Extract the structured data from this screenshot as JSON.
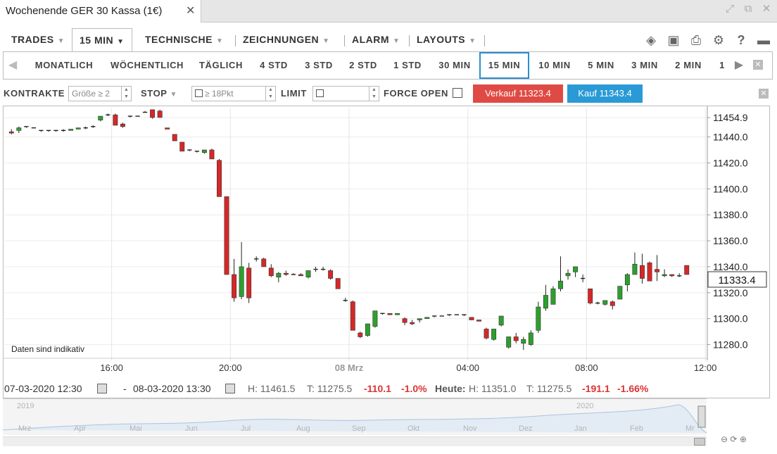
{
  "window": {
    "tab_title": "Wochenende GER 30 Kassa (1€)",
    "close_glyph": "✕"
  },
  "menu": {
    "trades": "TRADES",
    "interval": "15 MIN",
    "technische": "TECHNISCHE",
    "zeichnungen": "ZEICHNUNGEN",
    "alarm": "ALARM",
    "layouts": "LAYOUTS"
  },
  "toolbar_icons": [
    "layers-icon",
    "image-icon",
    "print-icon",
    "gear-icon",
    "help-icon",
    "chat-icon"
  ],
  "timeframes": [
    "MONATLICH",
    "WÖCHENTLICH",
    "TÄGLICH",
    "4 STD",
    "3 STD",
    "2 STD",
    "1 STD",
    "30 MIN",
    "15 MIN",
    "10 MIN",
    "5 MIN",
    "3 MIN",
    "2 MIN",
    "1"
  ],
  "active_timeframe": "15 MIN",
  "order": {
    "kontrakte_label": "KONTRAKTE",
    "kontrakte_placeholder": "Größe ≥ 2",
    "stop_label": "STOP",
    "stop_placeholder": "≥ 18Pkt",
    "limit_label": "LIMIT",
    "force_open_label": "FORCE OPEN",
    "sell_label": "Verkauf 11323.4",
    "buy_label": "Kauf 11343.4"
  },
  "chart_note": "Daten sind indikativ",
  "current_price": "11333.4",
  "info": {
    "from": "07-03-2020 12:30",
    "dash": "-",
    "to": "08-03-2020 13:30",
    "h": "H: 11461.5",
    "t": "T: 11275.5",
    "chg": "-110.1",
    "chg_pct": "-1.0%",
    "heute_label": "Heute:",
    "heute_h": "H: 11351.0",
    "heute_t": "T: 11275.5",
    "heute_chg": "-191.1",
    "heute_chg_pct": "-1.66%"
  },
  "navigator": {
    "years": [
      "2019",
      "2020"
    ],
    "months": [
      "Mrz",
      "Apr",
      "Mai",
      "Jun",
      "Jul",
      "Aug",
      "Sep",
      "Okt",
      "Nov",
      "Dez",
      "Jan",
      "Feb",
      "Mr"
    ]
  },
  "colors": {
    "up": "#2ca02c",
    "down": "#d62728",
    "sell": "#e04a44",
    "buy": "#2a9ad6",
    "active": "#2a8fd0"
  },
  "chart_data": {
    "type": "candlestick",
    "ylim": [
      11270,
      11462
    ],
    "yticks": [
      11280.0,
      11300.0,
      11320.0,
      11340.0,
      11360.0,
      11380.0,
      11400.0,
      11420.0,
      11440.0,
      11454.9
    ],
    "ytick_labels": [
      "11280.0",
      "11300.0",
      "11320.0",
      "11340.0",
      "11360.0",
      "11380.0",
      "11400.0",
      "11420.0",
      "11440.0",
      "11454.9"
    ],
    "xticks": [
      "16:00",
      "20:00",
      "08 Mrz",
      "04:00",
      "08:00",
      "12:00"
    ],
    "candles": [
      [
        11444,
        11446,
        11442,
        11443
      ],
      [
        11445,
        11448,
        11443,
        11447
      ],
      [
        11448,
        11448,
        11447,
        11448
      ],
      [
        11447,
        11447,
        11447,
        11447
      ],
      [
        11445,
        11445,
        11444,
        11445
      ],
      [
        11445,
        11445,
        11444,
        11445
      ],
      [
        11445,
        11445,
        11444,
        11445
      ],
      [
        11445,
        11446,
        11444,
        11445
      ],
      [
        11445,
        11446,
        11445,
        11446
      ],
      [
        11446,
        11447,
        11446,
        11447
      ],
      [
        11447,
        11448,
        11446,
        11447
      ],
      [
        11448,
        11449,
        11447,
        11448
      ],
      [
        11453,
        11456,
        11452,
        11456
      ],
      [
        11457,
        11458,
        11456,
        11457
      ],
      [
        11457,
        11458,
        11449,
        11449
      ],
      [
        11450,
        11451,
        11447,
        11448
      ],
      [
        11456,
        11456,
        11455,
        11456
      ],
      [
        11456,
        11456,
        11456,
        11456
      ],
      [
        11459,
        11460,
        11459,
        11459
      ],
      [
        11461,
        11461,
        11454,
        11455
      ],
      [
        11460,
        11461,
        11455,
        11455
      ],
      [
        11447,
        11447,
        11446,
        11446
      ],
      [
        11442,
        11442,
        11437,
        11437
      ],
      [
        11436,
        11436,
        11429,
        11429
      ],
      [
        11430,
        11430,
        11429,
        11430
      ],
      [
        11429,
        11429,
        11428,
        11429
      ],
      [
        11428,
        11430,
        11427,
        11430
      ],
      [
        11430,
        11431,
        11423,
        11423
      ],
      [
        11422,
        11423,
        11394,
        11394
      ],
      [
        11394,
        11394,
        11334,
        11334
      ],
      [
        11334,
        11346,
        11313,
        11316
      ],
      [
        11317,
        11359,
        11315,
        11340
      ],
      [
        11339,
        11343,
        11312,
        11316
      ],
      [
        11346,
        11348,
        11344,
        11346
      ],
      [
        11346,
        11347,
        11340,
        11340
      ],
      [
        11339,
        11342,
        11332,
        11333
      ],
      [
        11332,
        11336,
        11328,
        11335
      ],
      [
        11335,
        11337,
        11333,
        11334
      ],
      [
        11334,
        11335,
        11334,
        11334
      ],
      [
        11334,
        11335,
        11333,
        11333
      ],
      [
        11332,
        11337,
        11331,
        11337
      ],
      [
        11338,
        11340,
        11336,
        11338
      ],
      [
        11338,
        11340,
        11337,
        11338
      ],
      [
        11337,
        11338,
        11330,
        11331
      ],
      [
        11331,
        11331,
        11323,
        11323
      ],
      [
        11314,
        11316,
        11313,
        11314
      ],
      [
        11313,
        11314,
        11291,
        11291
      ],
      [
        11289,
        11290,
        11285,
        11286
      ],
      [
        11287,
        11296,
        11286,
        11296
      ],
      [
        11294,
        11306,
        11293,
        11306
      ],
      [
        11304,
        11304,
        11303,
        11304
      ],
      [
        11304,
        11304,
        11303,
        11303
      ],
      [
        11303,
        11304,
        11303,
        11304
      ],
      [
        11300,
        11301,
        11295,
        11297
      ],
      [
        11297,
        11299,
        11295,
        11296
      ],
      [
        11299,
        11300,
        11297,
        11300
      ],
      [
        11300,
        11301,
        11300,
        11301
      ],
      [
        11302,
        11302,
        11301,
        11302
      ],
      [
        11302,
        11302,
        11302,
        11302
      ],
      [
        11303,
        11303,
        11302,
        11303
      ],
      [
        11303,
        11303,
        11303,
        11303
      ],
      [
        11303,
        11303,
        11302,
        11303
      ],
      [
        11301,
        11301,
        11299,
        11299
      ],
      [
        11299,
        11299,
        11298,
        11298
      ],
      [
        11292,
        11293,
        11284,
        11285
      ],
      [
        11284,
        11292,
        11283,
        11292
      ],
      [
        11295,
        11302,
        11294,
        11302
      ],
      [
        11278,
        11286,
        11277,
        11286
      ],
      [
        11286,
        11289,
        11281,
        11283
      ],
      [
        11281,
        11286,
        11276,
        11284
      ],
      [
        11280,
        11291,
        11279,
        11289
      ],
      [
        11291,
        11313,
        11289,
        11309
      ],
      [
        11308,
        11326,
        11306,
        11318
      ],
      [
        11311,
        11325,
        11311,
        11323
      ],
      [
        11323,
        11348,
        11321,
        11329
      ],
      [
        11333,
        11338,
        11330,
        11335
      ],
      [
        11336,
        11339,
        11332,
        11340
      ],
      [
        11331,
        11334,
        11328,
        11331
      ],
      [
        11323,
        11323,
        11311,
        11312
      ],
      [
        11312,
        11313,
        11311,
        11312
      ],
      [
        11311,
        11314,
        11310,
        11314
      ],
      [
        11313,
        11314,
        11307,
        11310
      ],
      [
        11315,
        11325,
        11315,
        11325
      ],
      [
        11326,
        11335,
        11321,
        11334
      ],
      [
        11334,
        11351,
        11334,
        11342
      ],
      [
        11341,
        11350,
        11327,
        11331
      ],
      [
        11343,
        11344,
        11330,
        11329
      ],
      [
        11338,
        11349,
        11329,
        11336
      ],
      [
        11333,
        11338,
        11332,
        11334
      ],
      [
        11334,
        11334,
        11332,
        11333
      ],
      [
        11333,
        11335,
        11332,
        11333
      ],
      [
        11341,
        11341,
        11334,
        11334
      ]
    ]
  }
}
